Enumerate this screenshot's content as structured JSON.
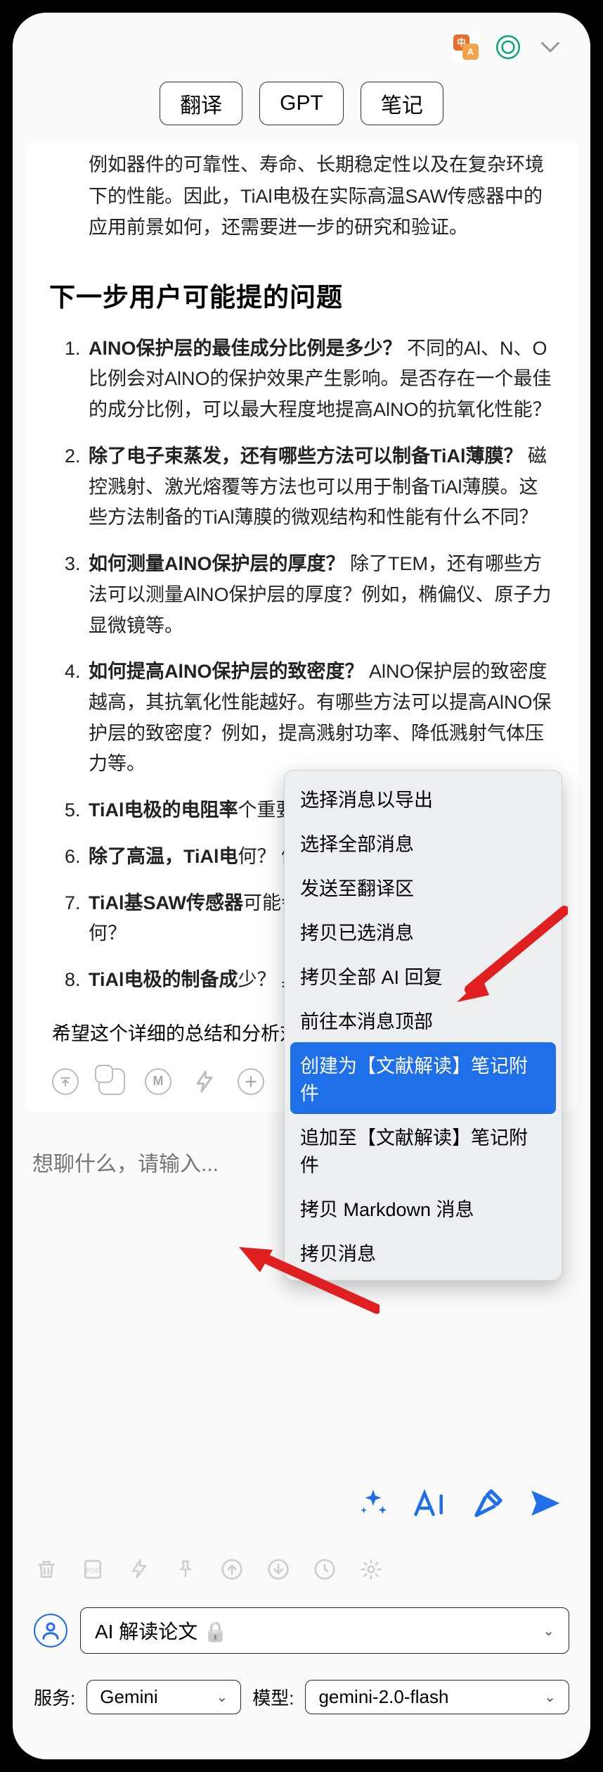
{
  "topbar": {
    "icon_translate": "translate-icon",
    "icon_openai": "openai-icon",
    "icon_chevron": "chevron-down-icon"
  },
  "tabs": {
    "translate": "翻译",
    "gpt": "GPT",
    "notes": "笔记"
  },
  "content": {
    "intro": "例如器件的可靠性、寿命、长期稳定性以及在复杂环境下的性能。因此，TiAl电极在实际高温SAW传感器中的应用前景如何，还需要进一步的研究和验证。",
    "section_title": "下一步用户可能提的问题",
    "questions": [
      {
        "b": "AlNO保护层的最佳成分比例是多少？",
        "rest": " 不同的Al、N、O比例会对AlNO的保护效果产生影响。是否存在一个最佳的成分比例，可以最大程度地提高AlNO的抗氧化性能？"
      },
      {
        "b": "除了电子束蒸发，还有哪些方法可以制备TiAl薄膜？",
        "rest": " 磁控溅射、激光熔覆等方法也可以用于制备TiAl薄膜。这些方法制备的TiAl薄膜的微观结构和性能有什么不同？"
      },
      {
        "b": "如何测量AlNO保护层的厚度？",
        "rest": " 除了TEM，还有哪些方法可以测量AlNO保护层的厚度？例如，椭偏仪、原子力显微镜等。"
      },
      {
        "b": "如何提高AlNO保护层的致密度？",
        "rest": " AlNO保护层的致密度越高，其抗氧化性能越好。有哪些方法可以提高AlNO保护层的致密度？例如，提高溅射功率、降低溅射气体压力等。"
      },
      {
        "b": "TiAl电极的电阻率",
        "rest": "个重要参数。TiAl电极的电阻率有什"
      },
      {
        "b": "除了高温，TiAl电",
        "rest": "何？ 例如，腐蚀性"
      },
      {
        "b": "TiAl基SAW传感器",
        "rest": "可能会影响SAW传器的灵敏度与传统何？"
      },
      {
        "b": "TiAl电极的制备成",
        "rest": "少？ 具体的成本陈业应用至关重要。"
      }
    ],
    "closing": "希望这个详细的总结和分析对您有所帮助！"
  },
  "context_menu": {
    "items": [
      "选择消息以导出",
      "选择全部消息",
      "发送至翻译区",
      "拷贝已选消息",
      "拷贝全部 AI 回复",
      "前往本消息顶部",
      "创建为【文献解读】笔记附件",
      "追加至【文献解读】笔记附件",
      "拷贝 Markdown 消息",
      "拷贝消息"
    ],
    "selected_index": 6
  },
  "chat_input": {
    "placeholder": "想聊什么，请输入..."
  },
  "profile": {
    "label": "AI 解读论文",
    "lock": "🔒"
  },
  "service": {
    "label": "服务:",
    "value": "Gemini"
  },
  "model": {
    "label": "模型:",
    "value": "gemini-2.0-flash"
  }
}
